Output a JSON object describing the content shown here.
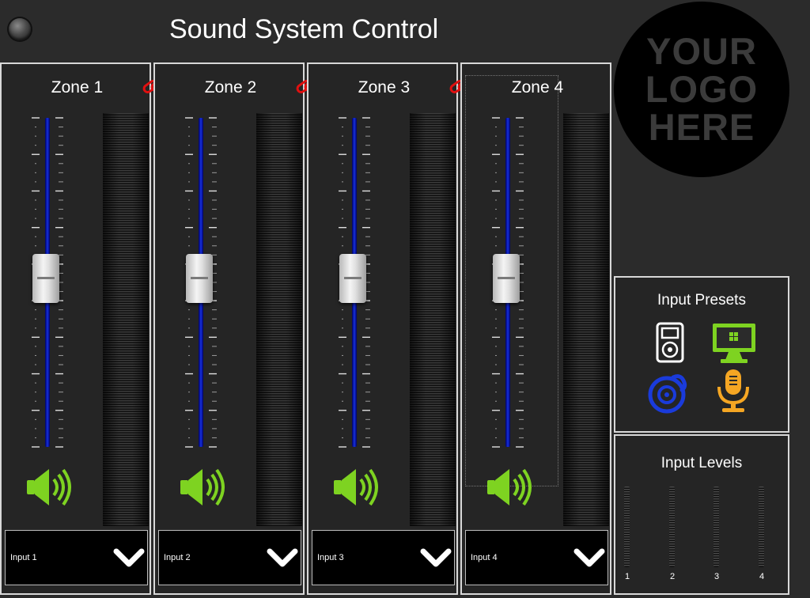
{
  "app": {
    "title": "Sound System Control"
  },
  "logo": {
    "lines": [
      "YOUR",
      "LOGO",
      "HERE"
    ]
  },
  "zones": [
    {
      "title": "Zone 1",
      "input": "Input 1",
      "link_icon": "unlink-icon"
    },
    {
      "title": "Zone 2",
      "input": "Input 2",
      "link_icon": "unlink-icon"
    },
    {
      "title": "Zone 3",
      "input": "Input 3",
      "link_icon": "unlink-icon"
    },
    {
      "title": "Zone 4",
      "input": "Input 4",
      "link_icon": null
    }
  ],
  "presets": {
    "title": "Input Presets",
    "items": [
      {
        "icon": "ipod-icon",
        "color": "#ffffff"
      },
      {
        "icon": "monitor-windows-icon",
        "color": "#7ed321"
      },
      {
        "icon": "disc-icon",
        "color": "#1a3bdb"
      },
      {
        "icon": "microphone-icon",
        "color": "#f5a623"
      }
    ]
  },
  "levels": {
    "title": "Input Levels",
    "channels": [
      "1",
      "2",
      "3",
      "4"
    ]
  },
  "colors": {
    "accent_green": "#7ed321",
    "link_red": "#e01010",
    "fader_blue": "#1530e0"
  }
}
